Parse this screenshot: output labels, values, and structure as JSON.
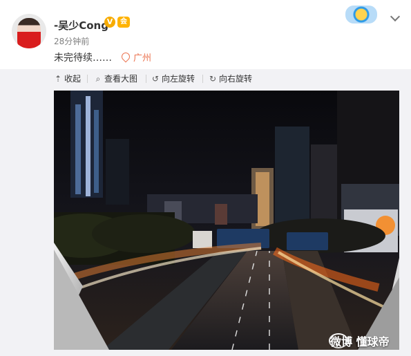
{
  "post": {
    "username": "-吴少Cong",
    "verified_badge": "V",
    "member_badge": "会",
    "time": "28分钟前",
    "text": "未完待续……",
    "location": "广州"
  },
  "toolbar": {
    "collapse": "收起",
    "view_large": "查看大图",
    "rotate_left": "向左旋转",
    "rotate_right": "向右旋转"
  },
  "watermark": "微博 懂球帝",
  "colors": {
    "location": "#eb7350",
    "toolbar_bg": "#f2f2f5",
    "verified": "#f7ab00"
  }
}
